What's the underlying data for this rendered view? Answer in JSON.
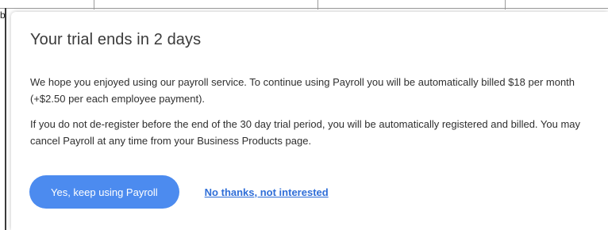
{
  "background": {
    "corner_glyph": "b"
  },
  "dialog": {
    "title": "Your trial ends in 2 days",
    "paragraphs": [
      "We hope you enjoyed using our payroll service. To continue using Payroll you will be automatically billed $18 per month (+$2.50 per each employee payment).",
      "If you do not de-register before the end of the 30 day trial period, you will be automatically registered and billed. You may cancel Payroll at any time from your Business Products page."
    ],
    "primary_button_label": "Yes, keep using Payroll",
    "secondary_link_label": "No thanks, not interested"
  },
  "colors": {
    "primary_button": "#4c8bef",
    "link": "#2f6ed8",
    "title_text": "#3b3b3b",
    "body_text": "#2f2f2f"
  }
}
